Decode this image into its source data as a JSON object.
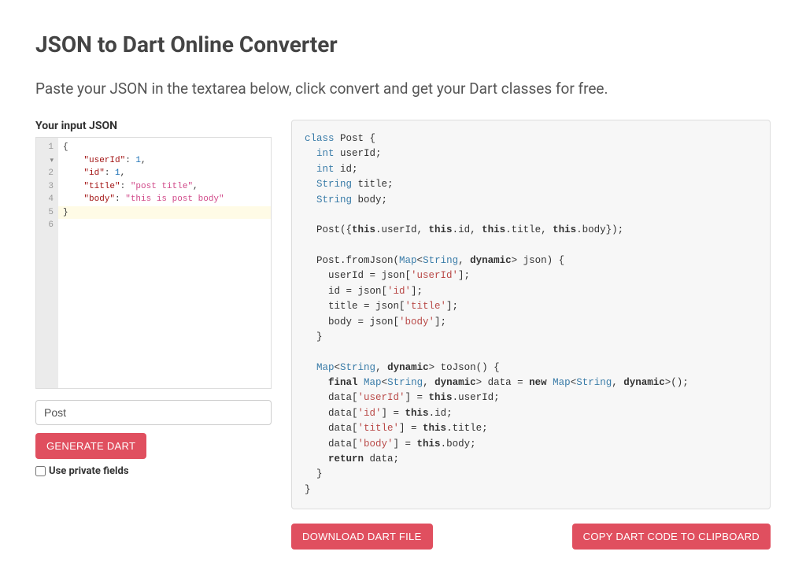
{
  "header": {
    "title": "JSON to Dart Online Converter",
    "subtitle": "Paste your JSON in the textarea below, click convert and get your Dart classes for free."
  },
  "left": {
    "label": "Your input JSON",
    "json_lines": [
      {
        "n": 1,
        "fold": true,
        "tokens": [
          {
            "t": "brace",
            "v": "{"
          }
        ]
      },
      {
        "n": 2,
        "tokens": [
          {
            "t": "indent",
            "v": "    "
          },
          {
            "t": "key",
            "v": "\"userId\""
          },
          {
            "t": "punc",
            "v": ": "
          },
          {
            "t": "num",
            "v": "1"
          },
          {
            "t": "punc",
            "v": ","
          }
        ]
      },
      {
        "n": 3,
        "tokens": [
          {
            "t": "indent",
            "v": "    "
          },
          {
            "t": "key",
            "v": "\"id\""
          },
          {
            "t": "punc",
            "v": ": "
          },
          {
            "t": "num",
            "v": "1"
          },
          {
            "t": "punc",
            "v": ","
          }
        ]
      },
      {
        "n": 4,
        "tokens": [
          {
            "t": "indent",
            "v": "    "
          },
          {
            "t": "key",
            "v": "\"title\""
          },
          {
            "t": "punc",
            "v": ": "
          },
          {
            "t": "str",
            "v": "\"post title\""
          },
          {
            "t": "punc",
            "v": ","
          }
        ]
      },
      {
        "n": 5,
        "tokens": [
          {
            "t": "indent",
            "v": "    "
          },
          {
            "t": "key",
            "v": "\"body\""
          },
          {
            "t": "punc",
            "v": ": "
          },
          {
            "t": "str",
            "v": "\"this is post body\""
          }
        ]
      },
      {
        "n": 6,
        "hl": true,
        "tokens": [
          {
            "t": "brace",
            "v": "}"
          }
        ]
      }
    ],
    "classname_value": "Post",
    "generate_label": "GENERATE DART",
    "private_label": "Use private fields"
  },
  "output": {
    "tokens": [
      {
        "t": "kw",
        "v": "class"
      },
      {
        "t": "txt",
        "v": " Post {\n  "
      },
      {
        "t": "kw",
        "v": "int"
      },
      {
        "t": "txt",
        "v": " userId;\n  "
      },
      {
        "t": "kw",
        "v": "int"
      },
      {
        "t": "txt",
        "v": " id;\n  "
      },
      {
        "t": "kw",
        "v": "String"
      },
      {
        "t": "txt",
        "v": " title;\n  "
      },
      {
        "t": "kw",
        "v": "String"
      },
      {
        "t": "txt",
        "v": " body;\n\n  Post({"
      },
      {
        "t": "kw2",
        "v": "this"
      },
      {
        "t": "txt",
        "v": ".userId, "
      },
      {
        "t": "kw2",
        "v": "this"
      },
      {
        "t": "txt",
        "v": ".id, "
      },
      {
        "t": "kw2",
        "v": "this"
      },
      {
        "t": "txt",
        "v": ".title, "
      },
      {
        "t": "kw2",
        "v": "this"
      },
      {
        "t": "txt",
        "v": ".body});\n\n  Post.fromJson("
      },
      {
        "t": "kw",
        "v": "Map"
      },
      {
        "t": "txt",
        "v": "<"
      },
      {
        "t": "kw",
        "v": "String"
      },
      {
        "t": "txt",
        "v": ", "
      },
      {
        "t": "kw2",
        "v": "dynamic"
      },
      {
        "t": "txt",
        "v": "> json) {\n    userId = json["
      },
      {
        "t": "str2",
        "v": "'userId'"
      },
      {
        "t": "txt",
        "v": "];\n    id = json["
      },
      {
        "t": "str2",
        "v": "'id'"
      },
      {
        "t": "txt",
        "v": "];\n    title = json["
      },
      {
        "t": "str2",
        "v": "'title'"
      },
      {
        "t": "txt",
        "v": "];\n    body = json["
      },
      {
        "t": "str2",
        "v": "'body'"
      },
      {
        "t": "txt",
        "v": "];\n  }\n\n  "
      },
      {
        "t": "kw",
        "v": "Map"
      },
      {
        "t": "txt",
        "v": "<"
      },
      {
        "t": "kw",
        "v": "String"
      },
      {
        "t": "txt",
        "v": ", "
      },
      {
        "t": "kw2",
        "v": "dynamic"
      },
      {
        "t": "txt",
        "v": "> toJson() {\n    "
      },
      {
        "t": "kw2",
        "v": "final"
      },
      {
        "t": "txt",
        "v": " "
      },
      {
        "t": "kw",
        "v": "Map"
      },
      {
        "t": "txt",
        "v": "<"
      },
      {
        "t": "kw",
        "v": "String"
      },
      {
        "t": "txt",
        "v": ", "
      },
      {
        "t": "kw2",
        "v": "dynamic"
      },
      {
        "t": "txt",
        "v": "> data = "
      },
      {
        "t": "kw2",
        "v": "new"
      },
      {
        "t": "txt",
        "v": " "
      },
      {
        "t": "kw",
        "v": "Map"
      },
      {
        "t": "txt",
        "v": "<"
      },
      {
        "t": "kw",
        "v": "String"
      },
      {
        "t": "txt",
        "v": ", "
      },
      {
        "t": "kw2",
        "v": "dynamic"
      },
      {
        "t": "txt",
        "v": ">();\n    data["
      },
      {
        "t": "str2",
        "v": "'userId'"
      },
      {
        "t": "txt",
        "v": "] = "
      },
      {
        "t": "kw2",
        "v": "this"
      },
      {
        "t": "txt",
        "v": ".userId;\n    data["
      },
      {
        "t": "str2",
        "v": "'id'"
      },
      {
        "t": "txt",
        "v": "] = "
      },
      {
        "t": "kw2",
        "v": "this"
      },
      {
        "t": "txt",
        "v": ".id;\n    data["
      },
      {
        "t": "str2",
        "v": "'title'"
      },
      {
        "t": "txt",
        "v": "] = "
      },
      {
        "t": "kw2",
        "v": "this"
      },
      {
        "t": "txt",
        "v": ".title;\n    data["
      },
      {
        "t": "str2",
        "v": "'body'"
      },
      {
        "t": "txt",
        "v": "] = "
      },
      {
        "t": "kw2",
        "v": "this"
      },
      {
        "t": "txt",
        "v": ".body;\n    "
      },
      {
        "t": "kw2",
        "v": "return"
      },
      {
        "t": "txt",
        "v": " data;\n  }\n}"
      }
    ],
    "download_label": "DOWNLOAD DART FILE",
    "copy_label": "COPY DART CODE TO CLIPBOARD"
  }
}
